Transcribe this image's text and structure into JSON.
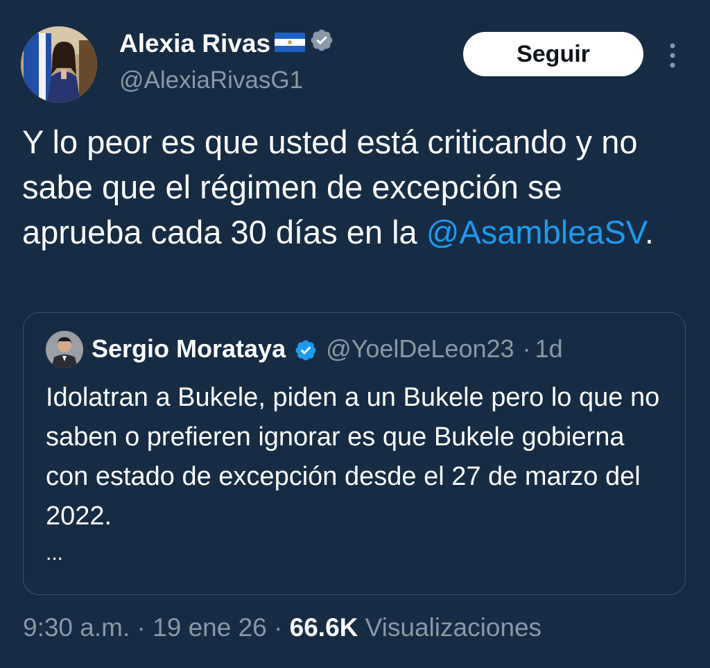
{
  "author": {
    "name": "Alexia Rivas",
    "handle": "@AlexiaRivasG1",
    "verified_icon": "verified-badge-icon",
    "flag_icon": "el-salvador-flag-icon"
  },
  "actions": {
    "follow_label": "Seguir",
    "more_icon": "more-vertical-icon"
  },
  "tweet": {
    "text": "Y lo peor es que usted está criticando y no sabe que el régimen de excepción se aprueba cada 30 días en la ",
    "mention": "@AsambleaSV",
    "suffix": "."
  },
  "quoted_tweet": {
    "name": "Sergio Morataya",
    "handle": "@YoelDeLeon23",
    "separator": "·",
    "time": "1d",
    "text": "Idolatran a Bukele, piden a un Bukele pero lo que no saben o prefieren ignorar es que Bukele gobierna con estado de excepción desde el 27 de marzo del 2022.",
    "ellipsis": "..."
  },
  "footer": {
    "time": "9:30 a.m.",
    "sep1": " · ",
    "date": "19 ene 26",
    "sep2": " · ",
    "views_count": "66.6K",
    "views_label": " Visualizaciones"
  },
  "colors": {
    "background": "#152c44",
    "link": "#1d9bf0",
    "secondary_text": "#8b98a5",
    "verified": "#1d9bf0"
  }
}
